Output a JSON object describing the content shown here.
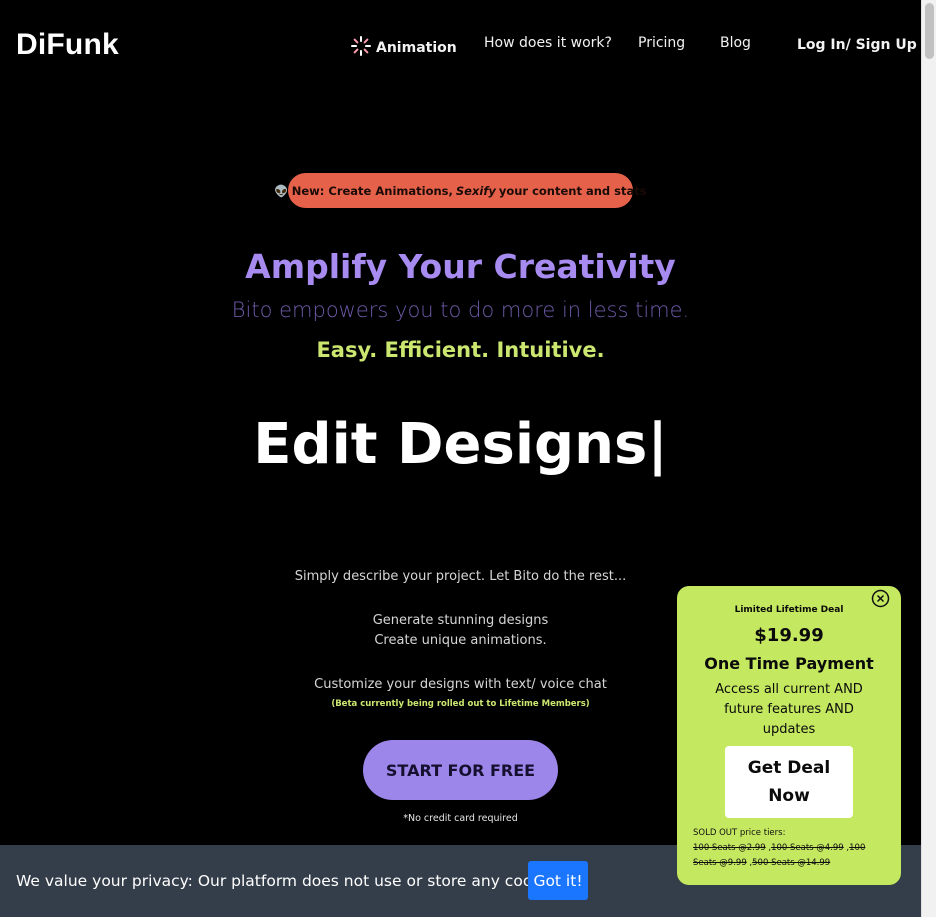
{
  "nav": {
    "logo": "DiFunk",
    "items": [
      {
        "label": "Animation",
        "icon": "sparkle-icon"
      },
      {
        "label": "How does it work?"
      },
      {
        "label": "Pricing"
      },
      {
        "label": "Blog"
      }
    ],
    "login": "Log In/ Sign Up"
  },
  "hero": {
    "badge_emoji": "👽",
    "badge_prefix": "New: Create Animations,",
    "badge_em": "Sexify",
    "badge_suffix": "your content and stats",
    "headline": "Amplify Your Creativity",
    "subline": "Bito empowers you to do more in less time.",
    "tagline": "Easy. Efficient. Intuitive.",
    "typed": "Edit Designs|",
    "desc1": "Simply describe your project. Let Bito do the rest...",
    "desc2": "Generate stunning designs",
    "desc3": "Create unique animations.",
    "desc4": "Customize your designs with text/ voice chat",
    "beta_note": "(Beta currently being rolled out to Lifetime Members)",
    "cta": "START FOR FREE",
    "no_card": "*No credit card required"
  },
  "cookie": {
    "text": "We value your privacy: Our platform does not use or store any cookies.",
    "button": "Got it!"
  },
  "deal": {
    "label": "Limited Lifetime Deal",
    "price": "$19.99",
    "one_time": "One Time Payment",
    "access": "Access all current AND future features AND updates",
    "button_line1": "Get Deal",
    "button_line2": "Now",
    "sold_out_label": "SOLD OUT price tiers:",
    "tiers": [
      "100 Seats @2.99",
      "100 Seats @4.99",
      "100 Seats @9.99",
      "500 Seats @14.99"
    ]
  },
  "colors": {
    "background": "#000000",
    "headline": "#a78bf0",
    "tagline": "#cbe770",
    "badge": "#e5614a",
    "deal_bg": "#c4e85f",
    "cookie_bar": "#343d4a",
    "cookie_button": "#1a75ff"
  }
}
